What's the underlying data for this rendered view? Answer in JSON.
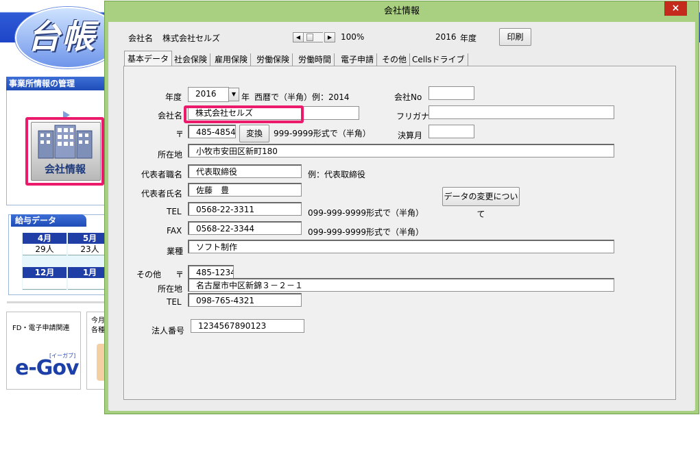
{
  "background_app": {
    "logo_text": "台帳",
    "panel_office": {
      "title": "事業所情報の管理",
      "company_button_label": "会社情報"
    },
    "panel_salary": {
      "title": "給与データ",
      "months": [
        {
          "month": "4月",
          "value": "29人"
        },
        {
          "month": "5月",
          "value": "23人"
        },
        {
          "month": "12月",
          "value": ""
        },
        {
          "month": "1月",
          "value": ""
        }
      ]
    },
    "cards": [
      {
        "title": "FD・電子申請関連",
        "logo": "e-Gov",
        "logo_sub": "[イーガブ]"
      },
      {
        "title": "今月\n各種"
      }
    ]
  },
  "dialog": {
    "title": "会社情報",
    "close_label": "×",
    "header": {
      "company_label": "会社名",
      "company_value": "株式会社セルズ",
      "zoom_value": "100%",
      "year_value": "2016",
      "year_label": "年度",
      "print_label": "印刷"
    },
    "tabs": [
      {
        "label": "基本データ",
        "active": true
      },
      {
        "label": "社会保険"
      },
      {
        "label": "雇用保険"
      },
      {
        "label": "労働保険"
      },
      {
        "label": "労働時間"
      },
      {
        "label": "電子申請"
      },
      {
        "label": "その他"
      },
      {
        "label": "Cellsドライブ"
      }
    ],
    "form": {
      "fiscal_year_label": "年度",
      "fiscal_year_value": "2016",
      "year_suffix": "年",
      "year_hint": "西暦で（半角）例：2014",
      "company_no_label": "会社No",
      "company_no_value": "",
      "company_name_label": "会社名",
      "company_name_value": "株式会社セルズ",
      "furigana_label": "フリガナ",
      "furigana_value": "",
      "postal_label": "〒",
      "postal_value": "485-4854",
      "convert_label": "変換",
      "postal_hint": "999-9999形式で（半角）",
      "settlement_label": "決算月",
      "settlement_value": "",
      "address_label": "所在地",
      "address_value": "小牧市安田区新町180",
      "rep_title_label": "代表者職名",
      "rep_title_value": "代表取締役",
      "rep_title_hint": "例：代表取締役",
      "rep_name_label": "代表者氏名",
      "rep_name_value": "佐藤　豊",
      "data_change_label": "データの変更について",
      "tel_label": "TEL",
      "tel_value": "0568-22-3311",
      "tel_hint": "099-999-9999形式で（半角）",
      "fax_label": "FAX",
      "fax_value": "0568-22-3344",
      "fax_hint": "099-999-9999形式で（半角）",
      "industry_label": "業種",
      "industry_value": "ソフト制作",
      "other_label": "その他",
      "other_postal_label": "〒",
      "other_postal_value": "485-1234",
      "other_address_label": "所在地",
      "other_address_value": "名古屋市中区新錦３－２－１",
      "other_tel_label": "TEL",
      "other_tel_value": "098-765-4321",
      "corp_no_label": "法人番号",
      "corp_no_value": "1234567890123"
    }
  },
  "colors": {
    "highlight": "#ec1a6a",
    "dialog_border": "#a6cf7f",
    "header_blue": "#1e45c8"
  }
}
